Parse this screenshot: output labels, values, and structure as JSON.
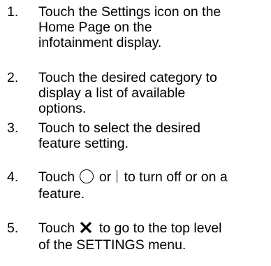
{
  "steps": [
    {
      "number": "1.",
      "lines": [
        "Touch the Settings icon on the",
        "Home Page on the",
        "infotainment display."
      ]
    },
    {
      "number": "2.",
      "lines": [
        "Touch the desired category to",
        "display a list of available",
        "options."
      ]
    },
    {
      "number": "3.",
      "lines": [
        "Touch to select the desired",
        "feature setting."
      ]
    },
    {
      "number": "4.",
      "line1_before": "Touch",
      "line1_middle": "or",
      "line1_after": "to turn off or on a",
      "line2": "feature.",
      "icons": [
        "off-circle-icon",
        "on-bar-icon"
      ]
    },
    {
      "number": "5.",
      "line1_before": "Touch",
      "line1_after": "to go to the top level",
      "line2": "of the SETTINGS menu.",
      "icons": [
        "close-x-icon"
      ]
    }
  ]
}
